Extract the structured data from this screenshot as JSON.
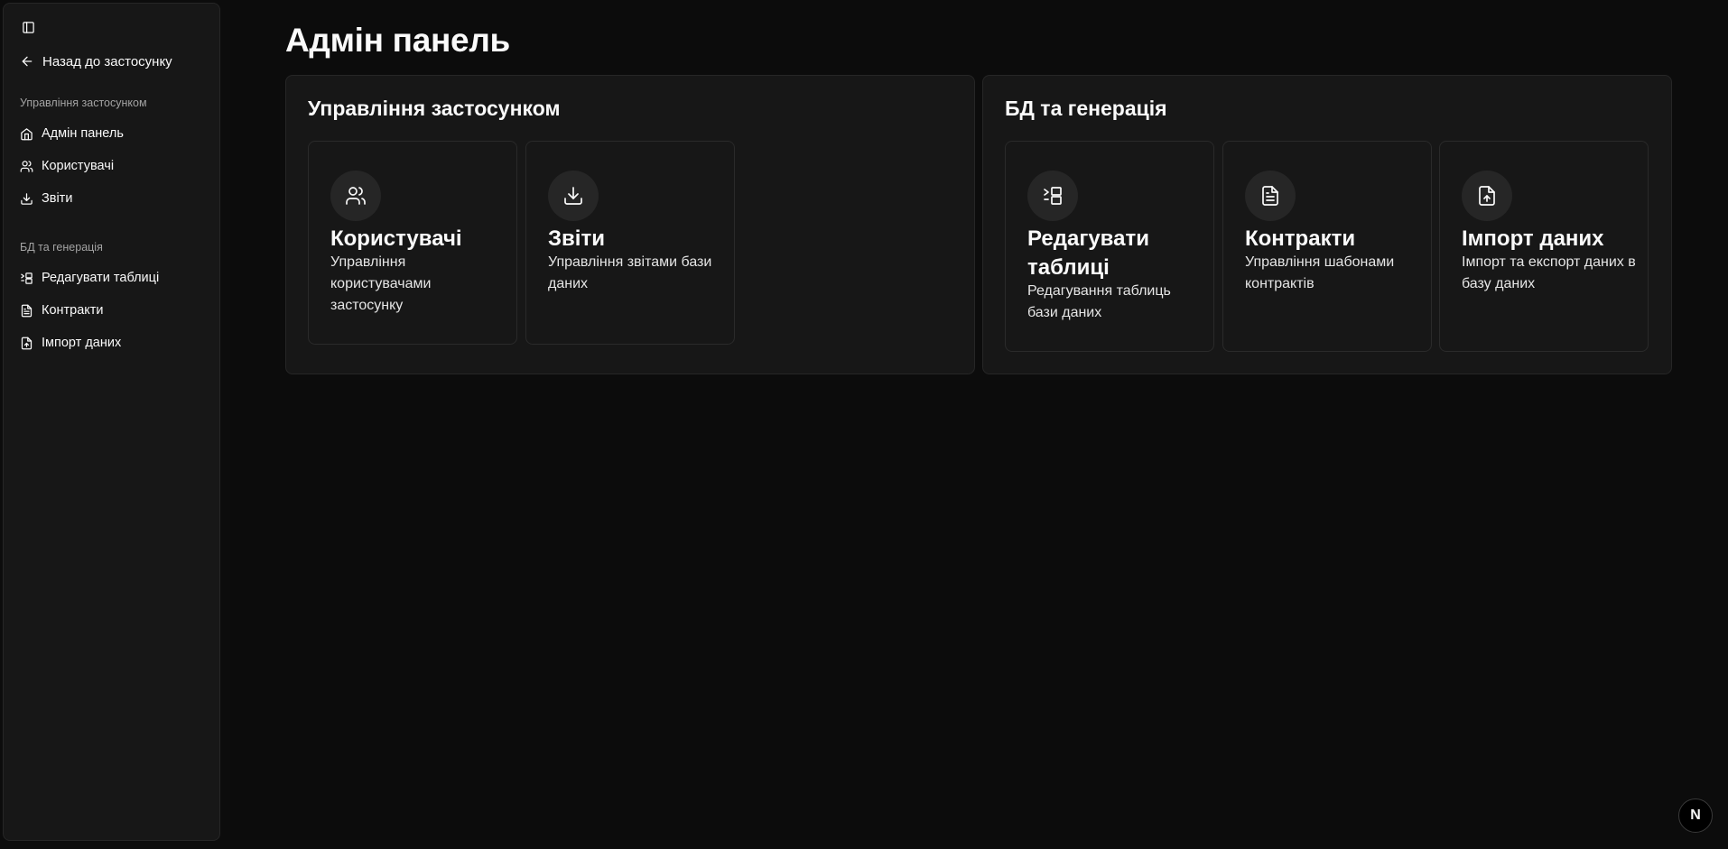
{
  "sidebar": {
    "toggle_icon": "panel-left-icon",
    "back_label": "Назад до застосунку",
    "groups": [
      {
        "label": "Управління застосунком",
        "items": [
          {
            "label": "Адмін панель",
            "icon": "home-icon"
          },
          {
            "label": "Користувачі",
            "icon": "users-icon"
          },
          {
            "label": "Звіти",
            "icon": "download-icon"
          }
        ]
      },
      {
        "label": "БД та генерація",
        "items": [
          {
            "label": "Редагувати таблиці",
            "icon": "table-edit-icon"
          },
          {
            "label": "Контракти",
            "icon": "file-text-icon"
          },
          {
            "label": "Імпорт даних",
            "icon": "file-upload-icon"
          }
        ]
      }
    ]
  },
  "main": {
    "title": "Адмін панель",
    "sections": [
      {
        "title": "Управління застосунком",
        "cards": [
          {
            "title": "Користувачі",
            "description": "Управління користувачами застосунку",
            "icon": "users-icon"
          },
          {
            "title": "Звіти",
            "description": "Управління звітами бази даних",
            "icon": "download-icon"
          }
        ]
      },
      {
        "title": "БД та генерація",
        "cards": [
          {
            "title": "Редагувати таблиці",
            "description": "Редагування таблиць бази даних",
            "icon": "table-edit-icon"
          },
          {
            "title": "Контракти",
            "description": "Управління шабонами контрактів",
            "icon": "file-text-icon"
          },
          {
            "title": "Імпорт даних",
            "description": "Імпорт та експорт даних в базу даних",
            "icon": "file-upload-icon"
          }
        ]
      }
    ]
  },
  "badge": {
    "label": "N",
    "icon": "nextjs-icon"
  },
  "colors": {
    "background": "#0c0c0c",
    "panel": "#171717",
    "border": "#262626",
    "text": "#fafafa",
    "muted": "#a3a3a3"
  }
}
